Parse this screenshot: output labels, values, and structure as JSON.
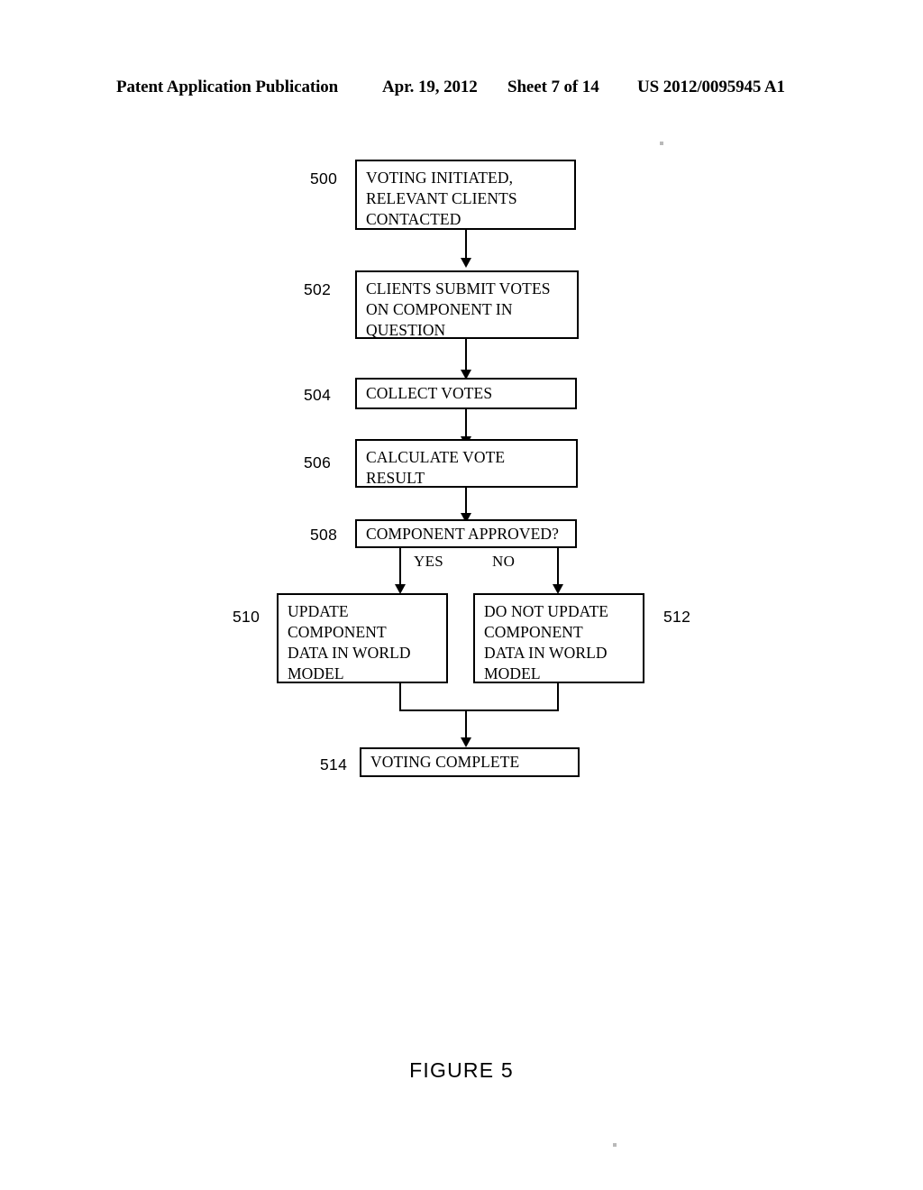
{
  "header": {
    "publication": "Patent Application Publication",
    "date": "Apr. 19, 2012",
    "sheet": "Sheet 7 of 14",
    "patent_number": "US 2012/0095945 A1"
  },
  "figure": {
    "caption": "FIGURE 5"
  },
  "flowchart": {
    "nodes": [
      {
        "ref": "500",
        "text": "VOTING INITIATED,\nRELEVANT CLIENTS\nCONTACTED"
      },
      {
        "ref": "502",
        "text": "CLIENTS SUBMIT VOTES\nON COMPONENT IN\nQUESTION"
      },
      {
        "ref": "504",
        "text": "COLLECT VOTES"
      },
      {
        "ref": "506",
        "text": "CALCULATE VOTE\nRESULT"
      },
      {
        "ref": "508",
        "text": "COMPONENT APPROVED?"
      },
      {
        "ref": "510",
        "text": "UPDATE\nCOMPONENT\nDATA IN WORLD\nMODEL"
      },
      {
        "ref": "512",
        "text": "DO NOT UPDATE\nCOMPONENT\nDATA IN WORLD\nMODEL"
      },
      {
        "ref": "514",
        "text": "VOTING COMPLETE"
      }
    ],
    "branches": [
      {
        "label": "YES"
      },
      {
        "label": "NO"
      }
    ]
  }
}
